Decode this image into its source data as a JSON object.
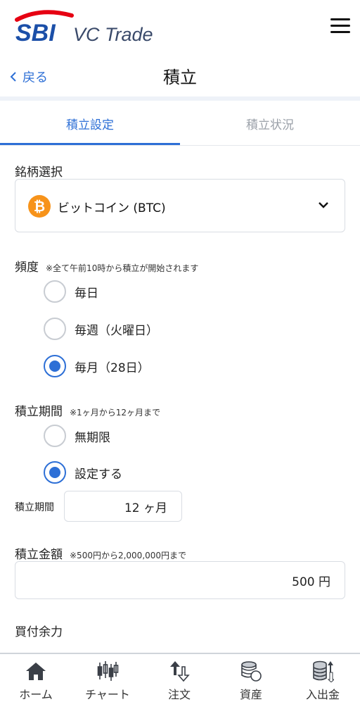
{
  "header": {
    "logo_sbi": "SBI",
    "logo_rest": "VC Trade"
  },
  "nav": {
    "back_label": "戻る",
    "title": "積立"
  },
  "tabs": [
    {
      "label": "積立設定",
      "active": true
    },
    {
      "label": "積立状況",
      "active": false
    }
  ],
  "form": {
    "symbol": {
      "label": "銘柄選択",
      "coin_glyph": "₿",
      "selected": "ビットコイン (BTC)"
    },
    "frequency": {
      "label": "頻度",
      "note": "※全て午前10時から積立が開始されます",
      "options": [
        {
          "label": "毎日",
          "checked": false
        },
        {
          "label": "毎週（火曜日）",
          "checked": false
        },
        {
          "label": "毎月（28日）",
          "checked": true
        }
      ]
    },
    "period": {
      "label": "積立期間",
      "note": "※1ヶ月から12ヶ月まで",
      "options": [
        {
          "label": "無期限",
          "checked": false
        },
        {
          "label": "設定する",
          "checked": true
        }
      ],
      "input_label": "積立期間",
      "input_value": "12 ヶ月"
    },
    "amount": {
      "label": "積立金額",
      "note": "※500円から2,000,000円まで",
      "value": "500 円"
    },
    "buying_power": {
      "label": "買付余力"
    }
  },
  "bottom_nav": [
    {
      "label": "ホーム",
      "icon": "home-icon"
    },
    {
      "label": "チャート",
      "icon": "chart-icon"
    },
    {
      "label": "注文",
      "icon": "order-icon"
    },
    {
      "label": "資産",
      "icon": "assets-icon"
    },
    {
      "label": "入出金",
      "icon": "deposit-withdraw-icon"
    }
  ],
  "colors": {
    "accent": "#2d6fd6",
    "brand_blue": "#1b4fa8",
    "brand_red": "#e60012",
    "bitcoin": "#f7931a"
  }
}
